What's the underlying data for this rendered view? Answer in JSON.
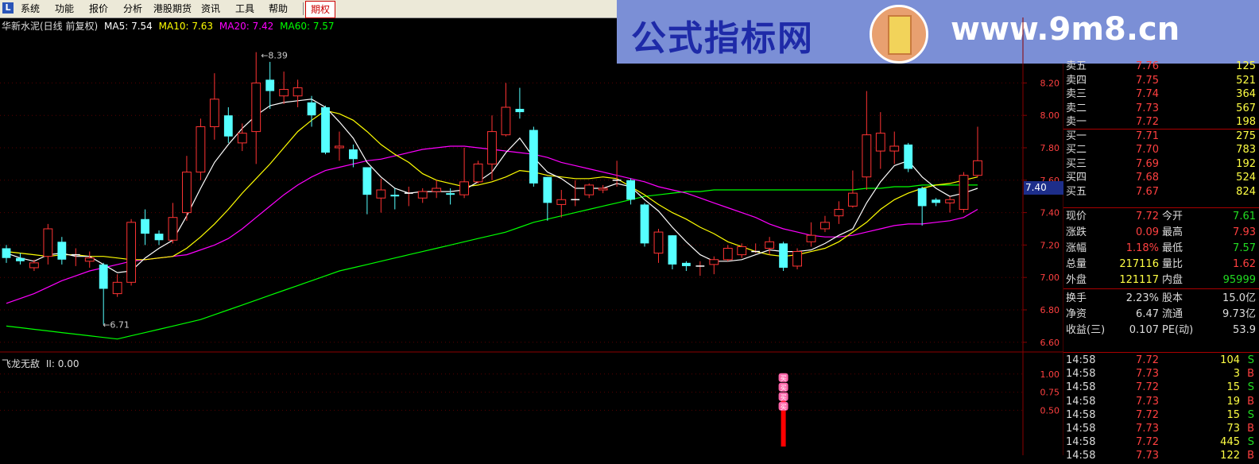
{
  "menu": {
    "logo_icon": "app-logo-icon",
    "items": [
      "系统",
      "功能",
      "报价",
      "分析",
      "港股期货",
      "资讯",
      "工具",
      "帮助"
    ],
    "active": "期权"
  },
  "banner": {
    "cn_text": "公式指标网",
    "url_text": "www.9m8.cn",
    "seal_text": "9m8.cn"
  },
  "header": {
    "stock_title": "华新水泥(日线 前复权)",
    "ma5_label": "MA5: 7.54",
    "ma10_label": "MA10: 7.63",
    "ma20_label": "MA20: 7.42",
    "ma60_label": "MA60: 7.57"
  },
  "indicator": {
    "name": "飞龙无敌",
    "value_label": "II: 0.00"
  },
  "colors": {
    "ma5": "#ffffff",
    "ma10": "#ffff00",
    "ma20": "#ff00ff",
    "ma60": "#00ff00",
    "up": "#ff3333",
    "down": "#55ffff",
    "axis": "#8b0000"
  },
  "chart_data": {
    "type": "candlestick",
    "price_axis_ticks": [
      "8.20",
      "8.00",
      "7.80",
      "7.60",
      "7.40",
      "7.20",
      "7.00",
      "6.80",
      "6.60"
    ],
    "price_ylim": [
      6.55,
      8.3
    ],
    "high_mark": "8.39",
    "low_mark": "6.71",
    "current_price_tag": "7.40",
    "indicator_axis_ticks": [
      "1.00",
      "0.75",
      "0.50"
    ],
    "indicator_ylim": [
      0,
      1.25
    ],
    "signal_bar": {
      "index": 56,
      "value": 1.0,
      "badge_label": "买"
    },
    "candles": [
      [
        7.18,
        7.12,
        7.2,
        7.09
      ],
      [
        7.12,
        7.1,
        7.15,
        7.08
      ],
      [
        7.06,
        7.09,
        7.11,
        7.04
      ],
      [
        7.13,
        7.3,
        7.33,
        7.08
      ],
      [
        7.22,
        7.11,
        7.25,
        7.08
      ],
      [
        7.14,
        7.14,
        7.18,
        7.07
      ],
      [
        7.1,
        7.12,
        7.16,
        7.06
      ],
      [
        7.08,
        6.93,
        7.09,
        6.71
      ],
      [
        6.9,
        6.97,
        7.02,
        6.88
      ],
      [
        6.97,
        7.34,
        7.36,
        6.95
      ],
      [
        7.36,
        7.27,
        7.42,
        7.2
      ],
      [
        7.27,
        7.23,
        7.29,
        7.2
      ],
      [
        7.23,
        7.37,
        7.46,
        7.21
      ],
      [
        7.4,
        7.65,
        7.75,
        7.35
      ],
      [
        7.65,
        7.93,
        7.98,
        7.6
      ],
      [
        7.93,
        8.1,
        8.26,
        7.85
      ],
      [
        8.0,
        7.87,
        8.05,
        7.83
      ],
      [
        7.83,
        7.89,
        7.95,
        7.78
      ],
      [
        7.9,
        8.2,
        8.39,
        7.7
      ],
      [
        8.22,
        8.15,
        8.33,
        8.04
      ],
      [
        8.12,
        8.16,
        8.27,
        8.07
      ],
      [
        8.12,
        8.17,
        8.22,
        8.05
      ],
      [
        8.08,
        8.0,
        8.12,
        7.93
      ],
      [
        8.05,
        7.77,
        8.06,
        7.76
      ],
      [
        7.8,
        7.81,
        7.9,
        7.72
      ],
      [
        7.79,
        7.73,
        7.82,
        7.68
      ],
      [
        7.68,
        7.51,
        7.68,
        7.39
      ],
      [
        7.49,
        7.54,
        7.61,
        7.4
      ],
      [
        7.51,
        7.5,
        7.55,
        7.42
      ],
      [
        7.52,
        7.52,
        7.56,
        7.44
      ],
      [
        7.49,
        7.53,
        7.55,
        7.46
      ],
      [
        7.53,
        7.55,
        7.6,
        7.49
      ],
      [
        7.52,
        7.51,
        7.55,
        7.45
      ],
      [
        7.51,
        7.59,
        7.8,
        7.49
      ],
      [
        7.59,
        7.7,
        7.72,
        7.58
      ],
      [
        7.7,
        7.9,
        8.0,
        7.6
      ],
      [
        7.88,
        8.05,
        8.2,
        7.87
      ],
      [
        8.04,
        8.02,
        8.17,
        7.98
      ],
      [
        7.91,
        7.58,
        7.93,
        7.56
      ],
      [
        7.62,
        7.46,
        7.62,
        7.35
      ],
      [
        7.45,
        7.48,
        7.54,
        7.37
      ],
      [
        7.48,
        7.48,
        7.6,
        7.44
      ],
      [
        7.51,
        7.57,
        7.58,
        7.49
      ],
      [
        7.54,
        7.55,
        7.57,
        7.52
      ],
      [
        7.6,
        7.6,
        7.72,
        7.56
      ],
      [
        7.6,
        7.48,
        7.61,
        7.45
      ],
      [
        7.45,
        7.21,
        7.46,
        7.19
      ],
      [
        7.15,
        7.28,
        7.3,
        7.09
      ],
      [
        7.26,
        7.08,
        7.26,
        7.05
      ],
      [
        7.09,
        7.07,
        7.1,
        7.04
      ],
      [
        7.07,
        7.07,
        7.1,
        7.01
      ],
      [
        7.08,
        7.11,
        7.13,
        7.02
      ],
      [
        7.11,
        7.18,
        7.2,
        7.1
      ],
      [
        7.14,
        7.19,
        7.21,
        7.12
      ],
      [
        7.16,
        7.16,
        7.21,
        7.15
      ],
      [
        7.18,
        7.22,
        7.25,
        7.14
      ],
      [
        7.21,
        7.06,
        7.22,
        7.04
      ],
      [
        7.07,
        7.16,
        7.18,
        7.05
      ],
      [
        7.22,
        7.26,
        7.34,
        7.19
      ],
      [
        7.3,
        7.34,
        7.38,
        7.28
      ],
      [
        7.38,
        7.42,
        7.47,
        7.33
      ],
      [
        7.44,
        7.52,
        7.66,
        7.43
      ],
      [
        7.62,
        7.88,
        8.15,
        7.54
      ],
      [
        7.78,
        7.89,
        8.02,
        7.67
      ],
      [
        7.78,
        7.81,
        7.9,
        7.7
      ],
      [
        7.82,
        7.67,
        7.83,
        7.65
      ],
      [
        7.55,
        7.44,
        7.56,
        7.32
      ],
      [
        7.48,
        7.46,
        7.49,
        7.44
      ],
      [
        7.46,
        7.48,
        7.5,
        7.4
      ],
      [
        7.42,
        7.63,
        7.65,
        7.4
      ],
      [
        7.63,
        7.72,
        7.93,
        7.62
      ]
    ],
    "ma5": [
      7.15,
      7.12,
      7.1,
      7.14,
      7.15,
      7.13,
      7.13,
      7.08,
      7.03,
      7.04,
      7.12,
      7.18,
      7.23,
      7.38,
      7.55,
      7.71,
      7.82,
      7.92,
      8.0,
      8.06,
      8.08,
      8.09,
      8.1,
      8.05,
      7.96,
      7.86,
      7.71,
      7.62,
      7.55,
      7.52,
      7.53,
      7.53,
      7.53,
      7.54,
      7.59,
      7.65,
      7.77,
      7.86,
      7.74,
      7.65,
      7.61,
      7.55,
      7.55,
      7.55,
      7.58,
      7.56,
      7.48,
      7.41,
      7.31,
      7.22,
      7.14,
      7.1,
      7.1,
      7.11,
      7.14,
      7.17,
      7.16,
      7.16,
      7.17,
      7.21,
      7.26,
      7.3,
      7.46,
      7.59,
      7.69,
      7.72,
      7.62,
      7.55,
      7.5,
      7.52,
      7.55
    ],
    "ma10": [
      7.16,
      7.15,
      7.14,
      7.13,
      7.14,
      7.14,
      7.13,
      7.13,
      7.12,
      7.11,
      7.11,
      7.12,
      7.13,
      7.18,
      7.25,
      7.33,
      7.42,
      7.52,
      7.61,
      7.7,
      7.8,
      7.9,
      7.97,
      8.03,
      8.01,
      7.97,
      7.9,
      7.82,
      7.76,
      7.71,
      7.64,
      7.6,
      7.58,
      7.56,
      7.57,
      7.59,
      7.62,
      7.66,
      7.65,
      7.63,
      7.62,
      7.61,
      7.61,
      7.62,
      7.61,
      7.56,
      7.51,
      7.45,
      7.4,
      7.36,
      7.31,
      7.27,
      7.22,
      7.19,
      7.16,
      7.14,
      7.13,
      7.14,
      7.16,
      7.18,
      7.22,
      7.28,
      7.34,
      7.42,
      7.48,
      7.52,
      7.55,
      7.57,
      7.58,
      7.6,
      7.62
    ],
    "ma20": [
      6.84,
      6.87,
      6.9,
      6.94,
      6.98,
      7.01,
      7.04,
      7.06,
      7.08,
      7.1,
      7.11,
      7.12,
      7.13,
      7.14,
      7.17,
      7.2,
      7.24,
      7.3,
      7.37,
      7.44,
      7.51,
      7.57,
      7.62,
      7.66,
      7.68,
      7.7,
      7.72,
      7.73,
      7.75,
      7.77,
      7.79,
      7.8,
      7.81,
      7.81,
      7.8,
      7.79,
      7.78,
      7.77,
      7.76,
      7.74,
      7.71,
      7.69,
      7.67,
      7.65,
      7.63,
      7.61,
      7.59,
      7.56,
      7.54,
      7.52,
      7.49,
      7.46,
      7.43,
      7.4,
      7.37,
      7.33,
      7.3,
      7.28,
      7.26,
      7.25,
      7.25,
      7.26,
      7.28,
      7.3,
      7.32,
      7.33,
      7.33,
      7.34,
      7.35,
      7.37,
      7.42
    ],
    "ma60": [
      6.7,
      6.69,
      6.68,
      6.67,
      6.66,
      6.65,
      6.64,
      6.63,
      6.62,
      6.64,
      6.66,
      6.68,
      6.7,
      6.72,
      6.74,
      6.77,
      6.8,
      6.83,
      6.86,
      6.89,
      6.92,
      6.95,
      6.98,
      7.01,
      7.04,
      7.06,
      7.08,
      7.1,
      7.12,
      7.14,
      7.16,
      7.18,
      7.2,
      7.22,
      7.24,
      7.26,
      7.28,
      7.31,
      7.34,
      7.36,
      7.38,
      7.4,
      7.42,
      7.44,
      7.46,
      7.48,
      7.5,
      7.51,
      7.52,
      7.53,
      7.53,
      7.54,
      7.54,
      7.54,
      7.54,
      7.54,
      7.54,
      7.54,
      7.54,
      7.54,
      7.54,
      7.54,
      7.55,
      7.55,
      7.56,
      7.56,
      7.57,
      7.57,
      7.57,
      7.57,
      7.57
    ]
  },
  "order_book": [
    {
      "label": "卖五",
      "price": "7.76",
      "vol": "125"
    },
    {
      "label": "卖四",
      "price": "7.75",
      "vol": "521"
    },
    {
      "label": "卖三",
      "price": "7.74",
      "vol": "364"
    },
    {
      "label": "卖二",
      "price": "7.73",
      "vol": "567"
    },
    {
      "label": "卖一",
      "price": "7.72",
      "vol": "198"
    },
    {
      "label": "买一",
      "price": "7.71",
      "vol": "275"
    },
    {
      "label": "买二",
      "price": "7.70",
      "vol": "783"
    },
    {
      "label": "买三",
      "price": "7.69",
      "vol": "192"
    },
    {
      "label": "买四",
      "price": "7.68",
      "vol": "524"
    },
    {
      "label": "买五",
      "price": "7.67",
      "vol": "824"
    }
  ],
  "quote_stats": [
    {
      "l1": "现价",
      "v1": "7.72",
      "l2": "今开",
      "v2": "7.61"
    },
    {
      "l1": "涨跌",
      "v1": "0.09",
      "l2": "最高",
      "v2": "7.93"
    },
    {
      "l1": "涨幅",
      "v1": "1.18%",
      "l2": "最低",
      "v2": "7.57"
    },
    {
      "l1": "总量",
      "v1": "217116",
      "l2": "量比",
      "v2": "1.62"
    },
    {
      "l1": "外盘",
      "v1": "121117",
      "l2": "内盘",
      "v2": "95999"
    }
  ],
  "fundamentals": [
    {
      "l1": "换手",
      "v1": "2.23%",
      "l2": "股本",
      "v2": "15.0亿"
    },
    {
      "l1": "净资",
      "v1": "6.47",
      "l2": "流通",
      "v2": "9.73亿"
    },
    {
      "l1": "收益(三)",
      "v1": "0.107",
      "l2": "PE(动)",
      "v2": "53.9"
    }
  ],
  "ticks": [
    {
      "time": "14:58",
      "price": "7.72",
      "vol": "104",
      "side": "S"
    },
    {
      "time": "14:58",
      "price": "7.73",
      "vol": "3",
      "side": "B"
    },
    {
      "time": "14:58",
      "price": "7.72",
      "vol": "15",
      "side": "S"
    },
    {
      "time": "14:58",
      "price": "7.73",
      "vol": "19",
      "side": "B"
    },
    {
      "time": "14:58",
      "price": "7.72",
      "vol": "15",
      "side": "S"
    },
    {
      "time": "14:58",
      "price": "7.73",
      "vol": "73",
      "side": "B"
    },
    {
      "time": "14:58",
      "price": "7.72",
      "vol": "445",
      "side": "S"
    },
    {
      "time": "14:58",
      "price": "7.73",
      "vol": "122",
      "side": "B"
    }
  ]
}
